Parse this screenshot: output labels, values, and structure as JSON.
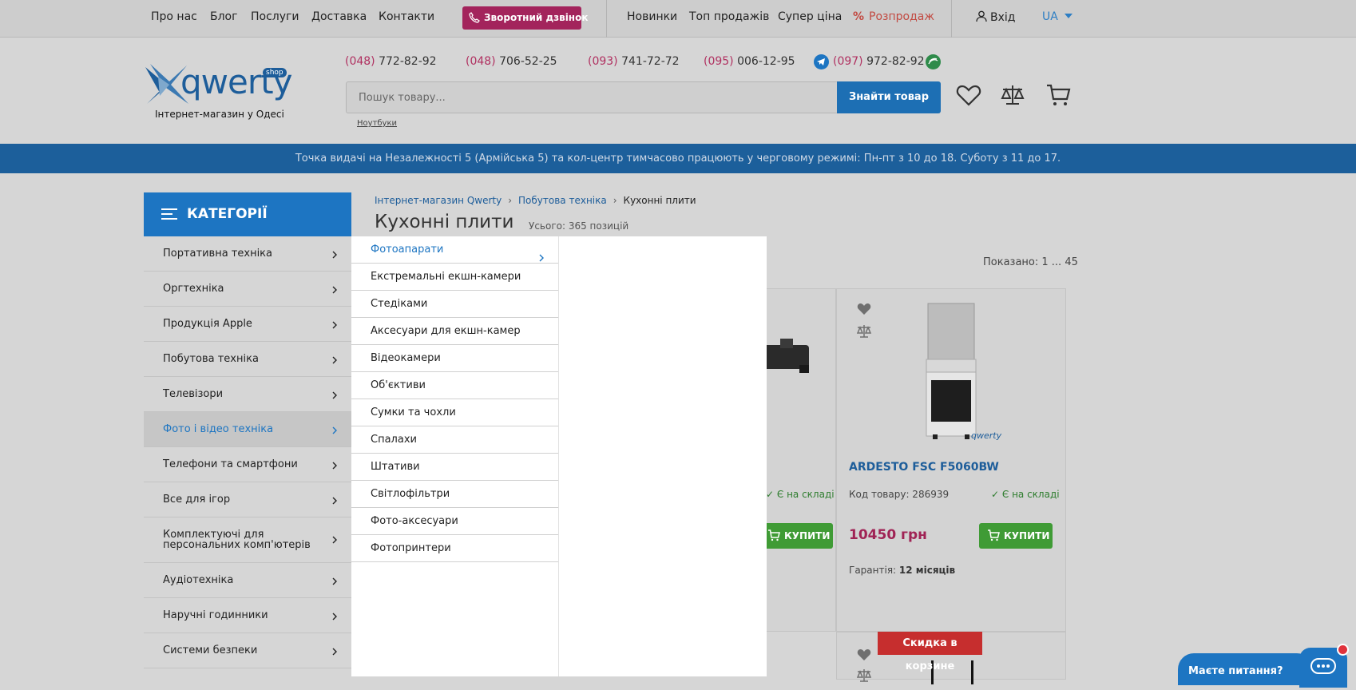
{
  "topbar": {
    "links": [
      "Про нас",
      "Блог",
      "Послуги",
      "Доставка",
      "Контакти"
    ],
    "callback": "Зворотний дзвінок",
    "right_links": [
      "Новинки",
      "Топ продажів",
      "Супер ціна"
    ],
    "sale": "Розпродаж",
    "login": "Вхід",
    "lang": "UA"
  },
  "header": {
    "logo_text": "qwerty",
    "logo_badge": "shop",
    "logo_sub": "Інтернет-магазин у Одесі",
    "phones": [
      {
        "code": "(048)",
        "num": " 772-82-92"
      },
      {
        "code": "(048)",
        "num": " 706-52-25"
      },
      {
        "code": "(093)",
        "num": " 741-72-72"
      },
      {
        "code": "(095)",
        "num": " 006-12-95"
      },
      {
        "code": "(097)",
        "num": " 972-82-92"
      }
    ],
    "search_placeholder": "Пошук товару...",
    "search_button": "Знайти товар",
    "search_hint": "Ноутбуки"
  },
  "notice": "Точка видачі на Незалежності 5 (Армійська 5) та кол-центр тимчасово працюють у черговому режимі: Пн-пт з 10 до 18. Суботу з 11 до 17.",
  "sidebar": {
    "title": "КАТЕГОРІЇ",
    "items": [
      "Портативна техніка",
      "Оргтехніка",
      "Продукція Apple",
      "Побутова техніка",
      "Телевізори",
      "Фото і відео техніка",
      "Телефони та смартфони",
      "Все для ігор",
      "Комплектуючі для персональних комп'ютерів",
      "Аудіотехніка",
      "Наручні годинники",
      "Системи безпеки"
    ],
    "active_index": 5
  },
  "submenu": {
    "items": [
      "Фотоапарати",
      "Екстремальні екшн-камери",
      "Стедіками",
      "Аксесуари для екшн-камер",
      "Відеокамери",
      "Об'єктиви",
      "Сумки та чохли",
      "Спалахи",
      "Штативи",
      "Світлофільтри",
      "Фото-аксесуари",
      "Фотопринтери"
    ],
    "active_index": 0
  },
  "content": {
    "breadcrumbs": [
      "Інтернет-магазин Qwerty",
      "Побутова техніка",
      "Кухонні плити"
    ],
    "title": "Кухонні плити",
    "total": "Усього: 365 позицій",
    "shown": "Показано: 1 ... 45",
    "product": {
      "name": "ARDESTO FSC F5060BW",
      "code": "Код товару: 286939",
      "stock": "Є на складі",
      "price": "10450 грн",
      "buy": "КУПИТИ",
      "warranty_label": "Гарантія:",
      "warranty_value": "12 місяців",
      "watermark": "qwerty"
    },
    "left_card": {
      "stock": "Є на складі",
      "buy": "КУПИТИ"
    },
    "discount_badge": "Скидка в корзине"
  },
  "chat": {
    "label": "Маєте питання?"
  }
}
